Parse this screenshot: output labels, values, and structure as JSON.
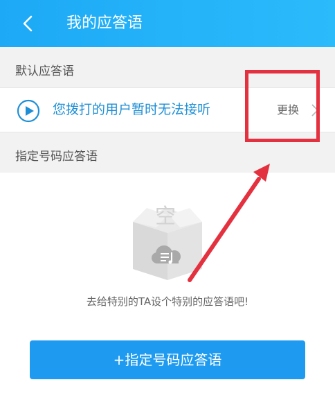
{
  "header": {
    "title": "我的应答语"
  },
  "sections": {
    "default_title": "默认应答语",
    "specific_title": "指定号码应答语"
  },
  "default_row": {
    "greeting": "您拨打的用户暂时无法接听",
    "change_label": "更换"
  },
  "empty_state": {
    "box_label": "空",
    "message": "去给特别的TA设个特别的应答语吧!"
  },
  "action_button": {
    "label": "+指定号码应答语"
  },
  "colors": {
    "header": "#1da9f6",
    "accent": "#1e8fd6",
    "button": "#1e9bf0",
    "annotation": "#e4313f"
  }
}
